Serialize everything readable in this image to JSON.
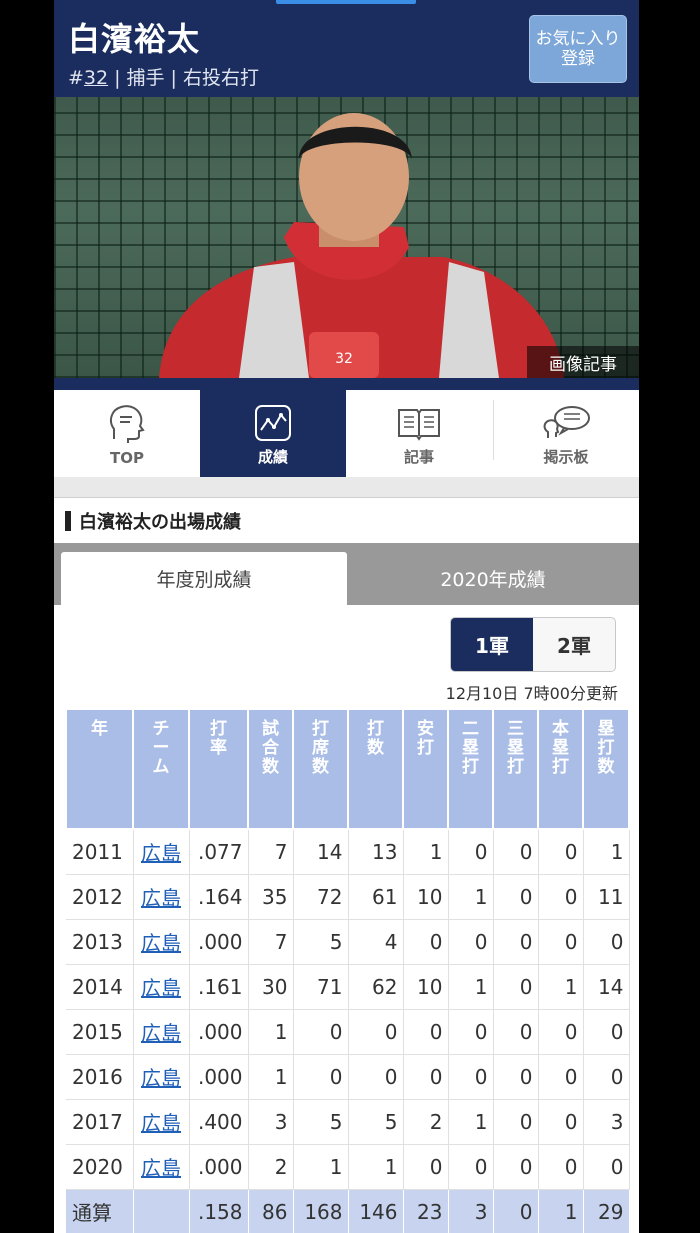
{
  "player": {
    "name": "白濱裕太",
    "number_prefix": "#",
    "number": "32",
    "separator": "|",
    "position": "捕手",
    "throw_bat": "右投右打"
  },
  "header": {
    "favorite_button": "お気に入り登録"
  },
  "photo": {
    "caption": "画像記事"
  },
  "tabs": [
    {
      "label": "TOP",
      "icon": "head-profile-icon"
    },
    {
      "label": "成績",
      "icon": "chart-icon"
    },
    {
      "label": "記事",
      "icon": "book-icon"
    },
    {
      "label": "掲示板",
      "icon": "chat-icon"
    }
  ],
  "section": {
    "title": "白濱裕太の出場成績"
  },
  "subtabs": [
    "年度別成績",
    "2020年成績"
  ],
  "squad_toggle": [
    "1軍",
    "2軍"
  ],
  "updated": "12月10日 7時00分更新",
  "stats": {
    "headers": [
      "年",
      "チーム",
      "打率",
      "試合数",
      "打席数",
      "打数",
      "安打",
      "二塁打",
      "三塁打",
      "本塁打",
      "塁打数"
    ],
    "rows": [
      [
        "2011",
        "広島",
        ".077",
        "7",
        "14",
        "13",
        "1",
        "0",
        "0",
        "0",
        "1"
      ],
      [
        "2012",
        "広島",
        ".164",
        "35",
        "72",
        "61",
        "10",
        "1",
        "0",
        "0",
        "11"
      ],
      [
        "2013",
        "広島",
        ".000",
        "7",
        "5",
        "4",
        "0",
        "0",
        "0",
        "0",
        "0"
      ],
      [
        "2014",
        "広島",
        ".161",
        "30",
        "71",
        "62",
        "10",
        "1",
        "0",
        "1",
        "14"
      ],
      [
        "2015",
        "広島",
        ".000",
        "1",
        "0",
        "0",
        "0",
        "0",
        "0",
        "0",
        "0"
      ],
      [
        "2016",
        "広島",
        ".000",
        "1",
        "0",
        "0",
        "0",
        "0",
        "0",
        "0",
        "0"
      ],
      [
        "2017",
        "広島",
        ".400",
        "3",
        "5",
        "5",
        "2",
        "1",
        "0",
        "0",
        "3"
      ],
      [
        "2020",
        "広島",
        ".000",
        "2",
        "1",
        "1",
        "0",
        "0",
        "0",
        "0",
        "0"
      ]
    ],
    "total": [
      "通算",
      "",
      ".158",
      "86",
      "168",
      "146",
      "23",
      "3",
      "0",
      "1",
      "29"
    ]
  },
  "colors": {
    "header_navy": "#1b2d5e",
    "favorite_button": "#7ca7d8",
    "table_header": "#a9bde6",
    "team_link": "#1f5fb8"
  }
}
